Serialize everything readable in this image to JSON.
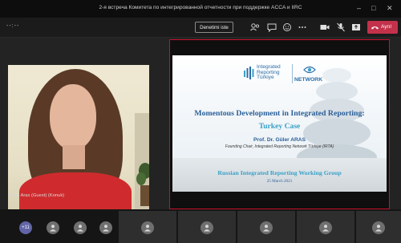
{
  "window": {
    "title": "2-я встреча Комитета по интегрированной отчетности при поддержке ACCA и IIRC",
    "controls": [
      "–",
      "□",
      "✕"
    ]
  },
  "toolbar": {
    "timer": "--:--",
    "stop_presenting_label": "Denetimi iste",
    "leave_label": "Ayrıl",
    "icons": [
      "people-icon",
      "chat-icon",
      "reactions-icon",
      "more-icon",
      "camera-icon",
      "mic-off-icon",
      "share-icon"
    ]
  },
  "participant": {
    "name": "Guler Aras (Guest) (Konuk)"
  },
  "slide": {
    "logo_lines": [
      "Integrated",
      "Reporting",
      "Türkiye"
    ],
    "network_label": "NETWORK",
    "title": "Momentous Development in Integrated Reporting:",
    "subtitle": "Turkey Case",
    "author": "Prof. Dr. Güler ARAS",
    "role": "Founding Chair, Integrated Reporting Network Türkiye (IRTA)",
    "group": "Russian Integrated Reporting Working Group",
    "date": "25 March 2021"
  },
  "strip": {
    "more_count": "+11"
  },
  "colors": {
    "leave": "#c4314b",
    "share_outline": "#c8102e",
    "slide_blue": "#2a5f98",
    "slide_teal": "#3aa0c8"
  }
}
